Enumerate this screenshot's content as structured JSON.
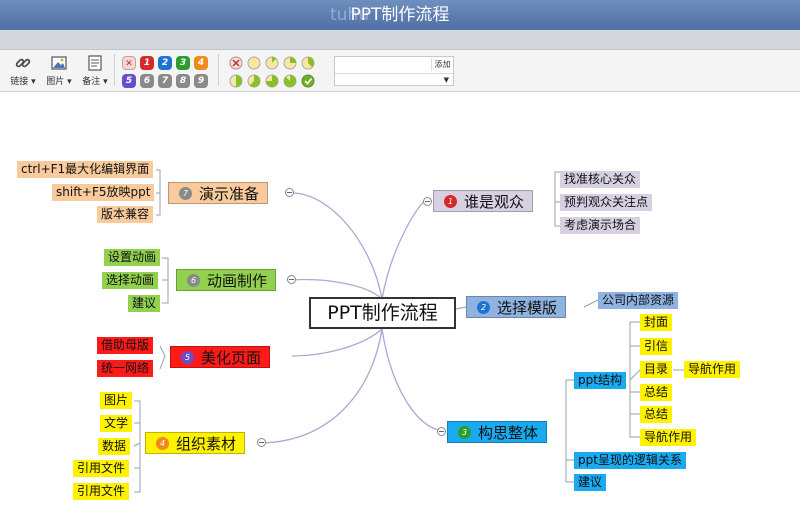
{
  "window": {
    "title": "PPT制作流程",
    "watermark": "tuhu"
  },
  "toolbar": {
    "link_label": "链接 ▾",
    "image_label": "图片 ▾",
    "note_label": "备注 ▾",
    "priority_icons": [
      "remove-priority",
      "1",
      "2",
      "3",
      "4",
      "5",
      "6",
      "7",
      "8",
      "9"
    ],
    "progress_levels": [
      "remove",
      0,
      0.125,
      0.25,
      0.375,
      0.5,
      0.625,
      0.75,
      0.875,
      1
    ],
    "tag_placeholder": "",
    "tag_add": "添加"
  },
  "colors": {
    "p1": "#d42a2a",
    "p2": "#1f74d1",
    "p3": "#2b9d2b",
    "p4": "#f08a1a",
    "p5": "#6a4fc7",
    "gray": "#8a8a8a"
  },
  "mindmap": {
    "root": "PPT制作流程",
    "topics": {
      "audience": {
        "num": "1",
        "label": "谁是观众",
        "children": [
          "找准核心关众",
          "预判观众关注点",
          "考虑演示场合"
        ]
      },
      "template": {
        "num": "2",
        "label": "选择模版",
        "children": [
          "公司内部资源"
        ]
      },
      "structure": {
        "num": "3",
        "label": "构思整体",
        "ppt_structure": {
          "label": "ppt结构",
          "children": [
            "封面",
            "引信",
            "目录",
            "总结",
            "总结",
            "导航作用"
          ],
          "toc_child": "导航作用"
        },
        "logic": "ppt呈现的逻辑关系",
        "advice": "建议"
      },
      "material": {
        "num": "4",
        "label": "组织素材",
        "children": [
          "图片",
          "文学",
          "数据",
          "引用文件",
          "引用文件"
        ]
      },
      "beautify": {
        "num": "5",
        "label": "美化页面",
        "children": [
          "借助母版",
          "统一网络"
        ]
      },
      "animation": {
        "num": "6",
        "label": "动画制作",
        "children": [
          "设置动画",
          "选择动画",
          "建议"
        ]
      },
      "prepare": {
        "num": "7",
        "label": "演示准备",
        "children": [
          "ctrl+F1最大化编辑界面",
          "shift+F5放映ppt",
          "版本兼容"
        ]
      }
    }
  }
}
